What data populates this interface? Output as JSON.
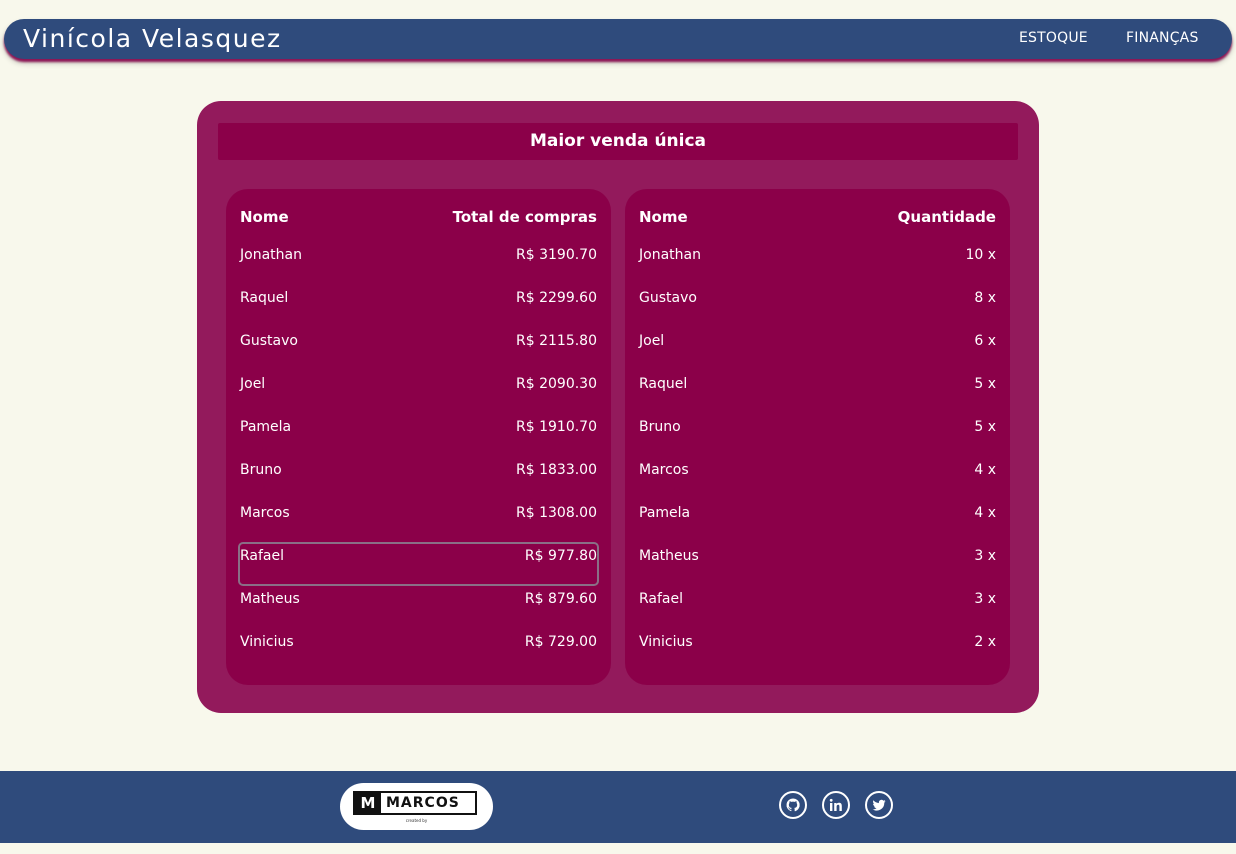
{
  "header": {
    "brand": "Vinícola Velasquez",
    "nav": [
      "ESTOQUE",
      "FINANÇAS"
    ]
  },
  "panel": {
    "title": "Maior venda única",
    "left_table": {
      "headers": [
        "Nome",
        "Total de compras"
      ],
      "rows": [
        {
          "name": "Jonathan",
          "value": "R$ 3190.70"
        },
        {
          "name": "Raquel",
          "value": "R$ 2299.60"
        },
        {
          "name": "Gustavo",
          "value": "R$ 2115.80"
        },
        {
          "name": "Joel",
          "value": "R$ 2090.30"
        },
        {
          "name": "Pamela",
          "value": "R$ 1910.70"
        },
        {
          "name": "Bruno",
          "value": "R$ 1833.00"
        },
        {
          "name": "Marcos",
          "value": "R$ 1308.00"
        },
        {
          "name": "Rafael",
          "value": "R$ 977.80"
        },
        {
          "name": "Matheus",
          "value": "R$ 879.60"
        },
        {
          "name": "Vinicius",
          "value": "R$ 729.00"
        }
      ]
    },
    "right_table": {
      "headers": [
        "Nome",
        "Quantidade"
      ],
      "rows": [
        {
          "name": "Jonathan",
          "value": "10 x"
        },
        {
          "name": "Gustavo",
          "value": "8 x"
        },
        {
          "name": "Joel",
          "value": "6 x"
        },
        {
          "name": "Raquel",
          "value": "5 x"
        },
        {
          "name": "Bruno",
          "value": "5 x"
        },
        {
          "name": "Marcos",
          "value": "4 x"
        },
        {
          "name": "Pamela",
          "value": "4 x"
        },
        {
          "name": "Matheus",
          "value": "3 x"
        },
        {
          "name": "Rafael",
          "value": "3 x"
        },
        {
          "name": "Vinicius",
          "value": "2 x"
        }
      ]
    }
  },
  "footer": {
    "logo": {
      "mark": "M",
      "word": "MARCOS",
      "caption": "created by"
    },
    "social": [
      "github-icon",
      "linkedin-icon",
      "twitter-icon"
    ]
  },
  "colors": {
    "navy": "#2f4b7c",
    "wine": "#8b0049",
    "panel": "#931a5c",
    "background": "#f8f8ec"
  }
}
